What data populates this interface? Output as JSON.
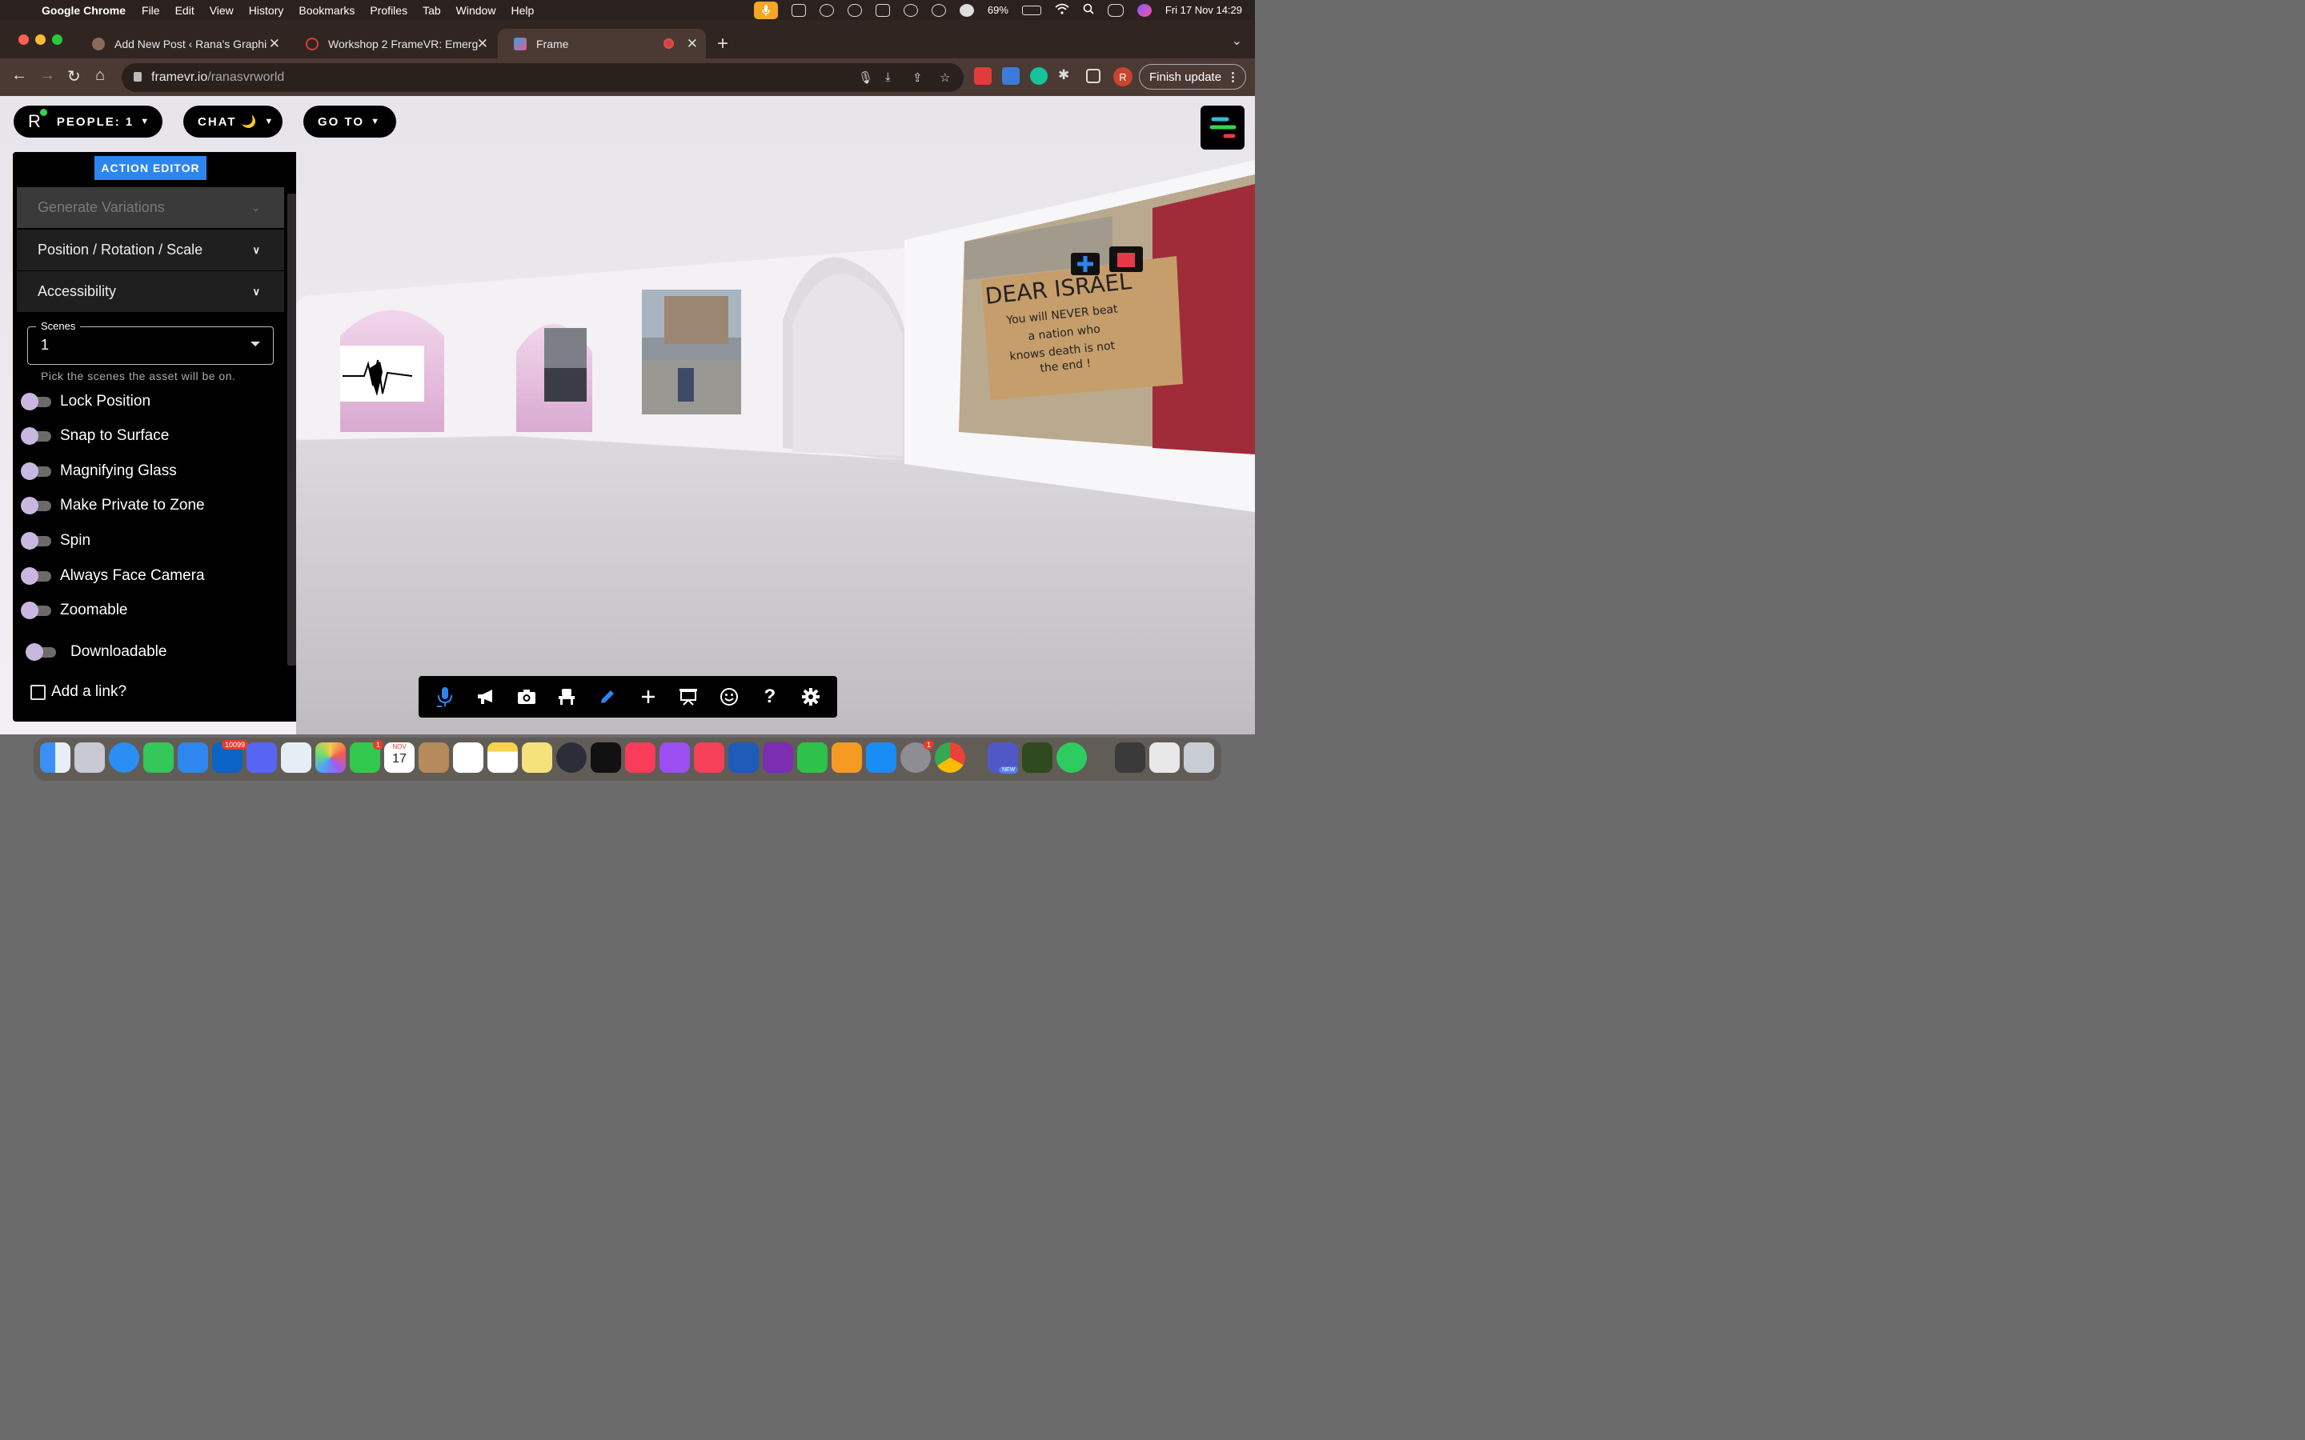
{
  "menubar": {
    "app_name": "Google Chrome",
    "items": [
      "File",
      "Edit",
      "View",
      "History",
      "Bookmarks",
      "Profiles",
      "Tab",
      "Window",
      "Help"
    ],
    "battery": "69%",
    "datetime": "Fri 17 Nov  14:29"
  },
  "tabs": [
    {
      "title": "Add New Post ‹ Rana's Graphi",
      "active": false
    },
    {
      "title": "Workshop 2 FrameVR: Emergi",
      "active": false
    },
    {
      "title": "Frame",
      "active": true
    }
  ],
  "address": {
    "domain": "framevr.io",
    "path": "/ranasvrworld"
  },
  "toolbar": {
    "profile_initial": "R",
    "finish_update_label": "Finish update"
  },
  "frame": {
    "user_initial": "R",
    "people_label": "PEOPLE: 1",
    "chat_label": "CHAT 🌙",
    "goto_label": "GO TO"
  },
  "panel": {
    "action_editor_label": "ACTION EDITOR",
    "sections": [
      {
        "label": "Generate Variations",
        "disabled": true
      },
      {
        "label": "Position / Rotation / Scale",
        "disabled": false
      },
      {
        "label": "Accessibility",
        "disabled": false
      }
    ],
    "scenes_label": "Scenes",
    "scenes_value": "1",
    "scenes_hint": "Pick the scenes the asset will be on.",
    "toggles": [
      {
        "label": "Lock Position",
        "on": false
      },
      {
        "label": "Snap to Surface",
        "on": false
      },
      {
        "label": "Magnifying Glass",
        "on": false
      },
      {
        "label": "Make Private to Zone",
        "on": false
      },
      {
        "label": "Spin",
        "on": false
      },
      {
        "label": "Always Face Camera",
        "on": false
      },
      {
        "label": "Zoomable",
        "on": false
      },
      {
        "label": "Downloadable",
        "on": false
      }
    ],
    "link_label": "Add a link?"
  },
  "bottom_toolbar": [
    "microphone-icon",
    "megaphone-icon",
    "camera-icon",
    "seat-icon",
    "pencil-icon",
    "plus-icon",
    "presentation-icon",
    "emoji-icon",
    "help-icon",
    "settings-icon"
  ],
  "artwork": {
    "sign_text": [
      "DEAR ISRAEL",
      "You will NEVER beat",
      "a nation who",
      "knows death is not",
      "the end !"
    ]
  },
  "dock": {
    "outlook_badge": "10099",
    "facetime_badge": "1",
    "calendar_month": "NOV",
    "calendar_day": "17",
    "settings_badge": "1",
    "teams_badge": "NEW"
  },
  "colors": {
    "accent_blue": "#2d86ef",
    "toggle_knob": "#c8b8df",
    "online_dot": "#3ad14b",
    "chrome_frame": "#4a3a33"
  }
}
